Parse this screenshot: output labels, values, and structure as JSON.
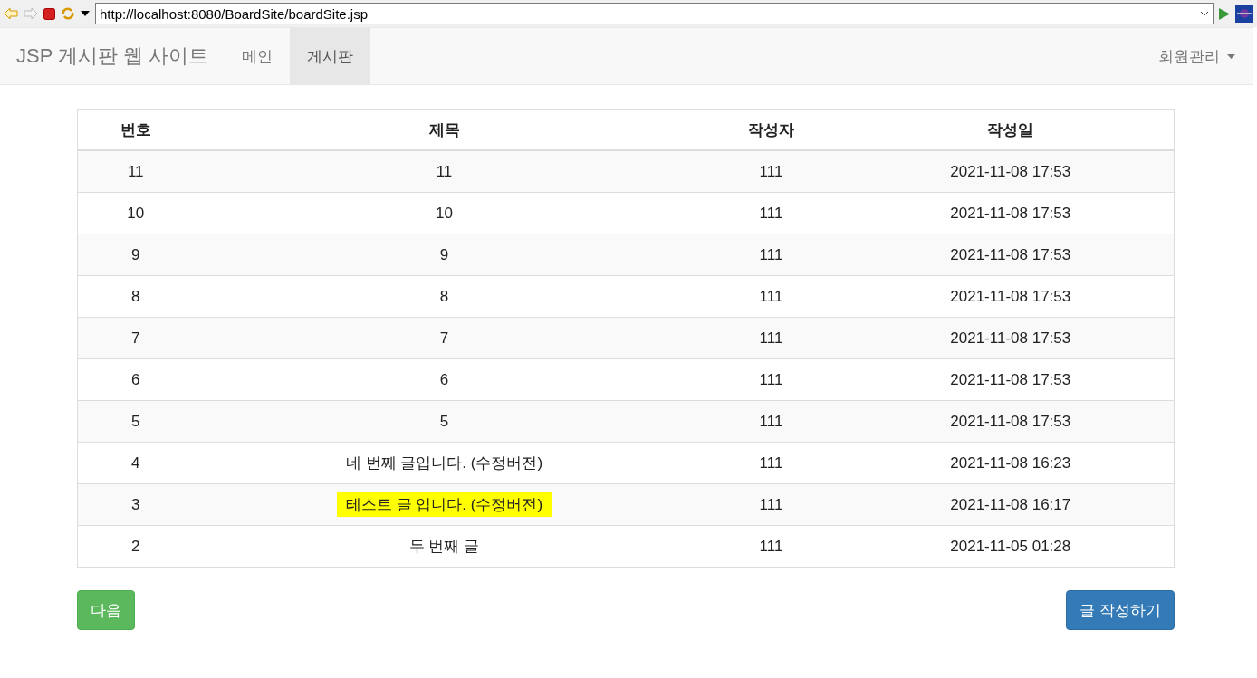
{
  "browser": {
    "url": "http://localhost:8080/BoardSite/boardSite.jsp"
  },
  "navbar": {
    "brand": "JSP 게시판 웹 사이트",
    "items": [
      {
        "label": "메인",
        "selected": false
      },
      {
        "label": "게시판",
        "selected": true
      }
    ],
    "dropdown": "회원관리"
  },
  "table": {
    "columns": [
      "번호",
      "제목",
      "작성자",
      "작성일"
    ],
    "rows": [
      {
        "number": "11",
        "title": "11",
        "author": "111",
        "date": "2021-11-08 17:53",
        "highlighted": false
      },
      {
        "number": "10",
        "title": "10",
        "author": "111",
        "date": "2021-11-08 17:53",
        "highlighted": false
      },
      {
        "number": "9",
        "title": "9",
        "author": "111",
        "date": "2021-11-08 17:53",
        "highlighted": false
      },
      {
        "number": "8",
        "title": "8",
        "author": "111",
        "date": "2021-11-08 17:53",
        "highlighted": false
      },
      {
        "number": "7",
        "title": "7",
        "author": "111",
        "date": "2021-11-08 17:53",
        "highlighted": false
      },
      {
        "number": "6",
        "title": "6",
        "author": "111",
        "date": "2021-11-08 17:53",
        "highlighted": false
      },
      {
        "number": "5",
        "title": "5",
        "author": "111",
        "date": "2021-11-08 17:53",
        "highlighted": false
      },
      {
        "number": "4",
        "title": "네 번째 글입니다. (수정버전)",
        "author": "111",
        "date": "2021-11-08 16:23",
        "highlighted": false
      },
      {
        "number": "3",
        "title": "테스트 글 입니다. (수정버전)",
        "author": "111",
        "date": "2021-11-08 16:17",
        "highlighted": true
      },
      {
        "number": "2",
        "title": "두 번째 글",
        "author": "111",
        "date": "2021-11-05 01:28",
        "highlighted": false
      }
    ]
  },
  "buttons": {
    "next": "다음",
    "write": "글 작성하기"
  }
}
